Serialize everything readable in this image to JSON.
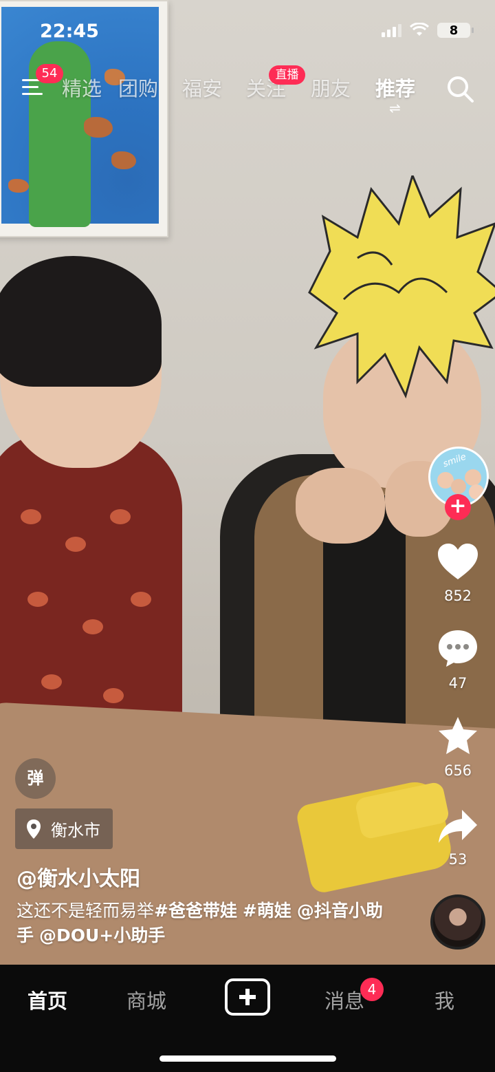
{
  "status_bar": {
    "time": "22:45",
    "battery": "8"
  },
  "top_nav": {
    "menu_badge": "54",
    "tabs": [
      {
        "label": "精选"
      },
      {
        "label": "团购"
      },
      {
        "label": "福安"
      },
      {
        "label": "关注"
      },
      {
        "label": "朋友"
      },
      {
        "label": "推荐"
      }
    ],
    "active_tab": "推荐",
    "live_badge": "直播",
    "swap_glyph": "⇌"
  },
  "creator_avatar": {
    "label": "smile",
    "follow_symbol": "+"
  },
  "actions": {
    "likes": "852",
    "comments": "47",
    "favorites": "656",
    "shares": "53"
  },
  "info": {
    "danmu": "弹",
    "location": "衡水市",
    "author": "@衡水小太阳",
    "caption_parts": [
      {
        "text": "这还不是轻而易举",
        "bold": false
      },
      {
        "text": "#爸爸带娃",
        "bold": true
      },
      {
        "text": " ",
        "bold": false
      },
      {
        "text": "#萌娃",
        "bold": true
      },
      {
        "text": " ",
        "bold": false
      },
      {
        "text": "@抖音小助手",
        "bold": true
      },
      {
        "text": " ",
        "bold": false
      },
      {
        "text": "@DOU+小助手",
        "bold": true
      }
    ]
  },
  "bottom_tabs": {
    "home": "首页",
    "mall": "商城",
    "create_symbol": "+",
    "messages": "消息",
    "messages_badge": "4",
    "me": "我"
  },
  "icons": [
    "menu-icon",
    "search-icon",
    "heart-icon",
    "comment-icon",
    "star-icon",
    "share-icon",
    "location-pin-icon",
    "plus-icon",
    "music-disc-icon",
    "signal-icon",
    "wifi-icon",
    "battery-icon"
  ],
  "colors": {
    "accent": "#fe2c55",
    "tabbar_bg": "#0b0b0b"
  }
}
